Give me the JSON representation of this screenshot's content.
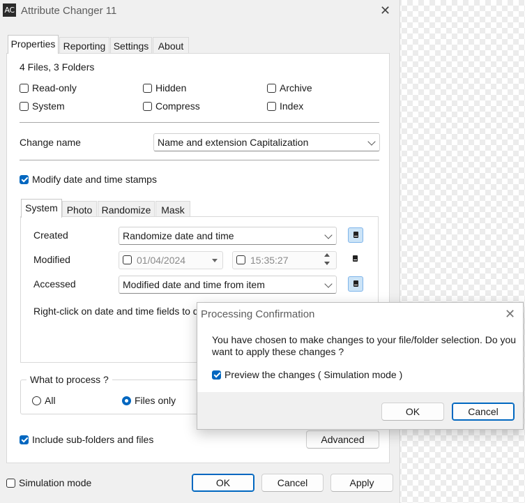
{
  "window": {
    "app_icon_text": "AC",
    "title": "Attribute Changer 11",
    "close_glyph": "✕"
  },
  "main_tabs": [
    {
      "label": "Properties",
      "selected": true
    },
    {
      "label": "Reporting",
      "selected": false
    },
    {
      "label": "Settings",
      "selected": false
    },
    {
      "label": "About",
      "selected": false
    }
  ],
  "properties": {
    "summary": "4 Files, 3 Folders",
    "attributes": [
      {
        "label": "Read-only",
        "checked": false
      },
      {
        "label": "Hidden",
        "checked": false
      },
      {
        "label": "Archive",
        "checked": false
      },
      {
        "label": "System",
        "checked": false
      },
      {
        "label": "Compress",
        "checked": false
      },
      {
        "label": "Index",
        "checked": false
      }
    ],
    "change_name_label": "Change name",
    "change_name_value": "Name and extension Capitalization",
    "modify_dates_label": "Modify date and time stamps",
    "modify_dates_checked": true
  },
  "date_tabs": [
    {
      "label": "System",
      "selected": true
    },
    {
      "label": "Photo",
      "selected": false
    },
    {
      "label": "Randomize",
      "selected": false
    },
    {
      "label": "Mask",
      "selected": false
    }
  ],
  "date_rows": {
    "created_label": "Created",
    "created_value": "Randomize date and time",
    "modified_label": "Modified",
    "modified_date": "01/04/2024",
    "modified_time": "15:35:27",
    "accessed_label": "Accessed",
    "accessed_value": "Modified date and time from item",
    "hint": "Right-click on date and time fields to dis"
  },
  "process_group": {
    "title": "What to process ?",
    "options": [
      {
        "label": "All",
        "selected": false
      },
      {
        "label": "Files only",
        "selected": true
      }
    ]
  },
  "include_subfolders_label": "Include sub-folders and files",
  "include_subfolders_checked": true,
  "advanced_button": "Advanced",
  "simulation_mode_label": "Simulation mode",
  "simulation_mode_checked": false,
  "footer_buttons": {
    "ok": "OK",
    "cancel": "Cancel",
    "apply": "Apply"
  },
  "dialog": {
    "title": "Processing Confirmation",
    "message_line1": "You have chosen to make changes to your file/folder selection.  Do you",
    "message_line2": "want to apply these changes ?",
    "preview_label": "Preview the changes ( Simulation mode )",
    "preview_checked": true,
    "ok": "OK",
    "cancel": "Cancel"
  },
  "colors": {
    "accent": "#0067c0",
    "window_bg": "#f0f0f0",
    "panel_bg": "#ffffff"
  }
}
